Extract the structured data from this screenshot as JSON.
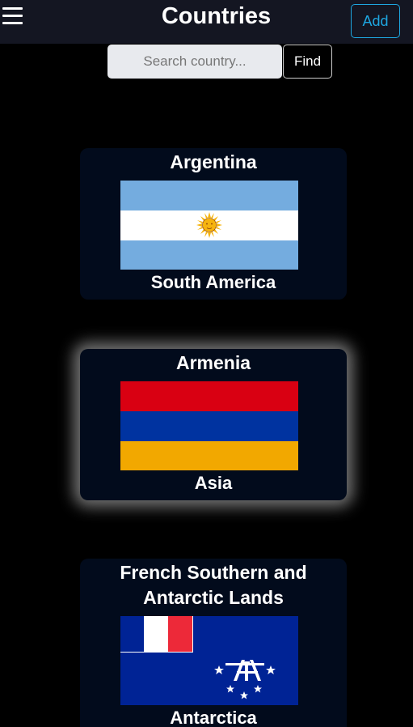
{
  "header": {
    "title": "Countries",
    "add_label": "Add",
    "menu_icon": "hamburger-menu-icon"
  },
  "search": {
    "placeholder": "Search country...",
    "value": "",
    "find_label": "Find"
  },
  "countries": [
    {
      "name": "Argentina",
      "region": "South America",
      "flag": "argentina-flag",
      "colors": {
        "blue": "#74acdf",
        "white": "#ffffff",
        "sun": "#f6b40e"
      }
    },
    {
      "name": "Armenia",
      "region": "Asia",
      "flag": "armenia-flag",
      "colors": {
        "red": "#d90012",
        "blue": "#0033a0",
        "orange": "#f2a800"
      }
    },
    {
      "name": "French Southern and Antarctic Lands",
      "region": "Antarctica",
      "flag": "french-southern-antarctic-lands-flag",
      "colors": {
        "blue": "#002395",
        "white": "#ffffff",
        "red": "#ed2939"
      }
    }
  ],
  "colors": {
    "background": "#000000",
    "header": "#141622",
    "card": "#020b1c",
    "accent": "#1ea7e1"
  }
}
